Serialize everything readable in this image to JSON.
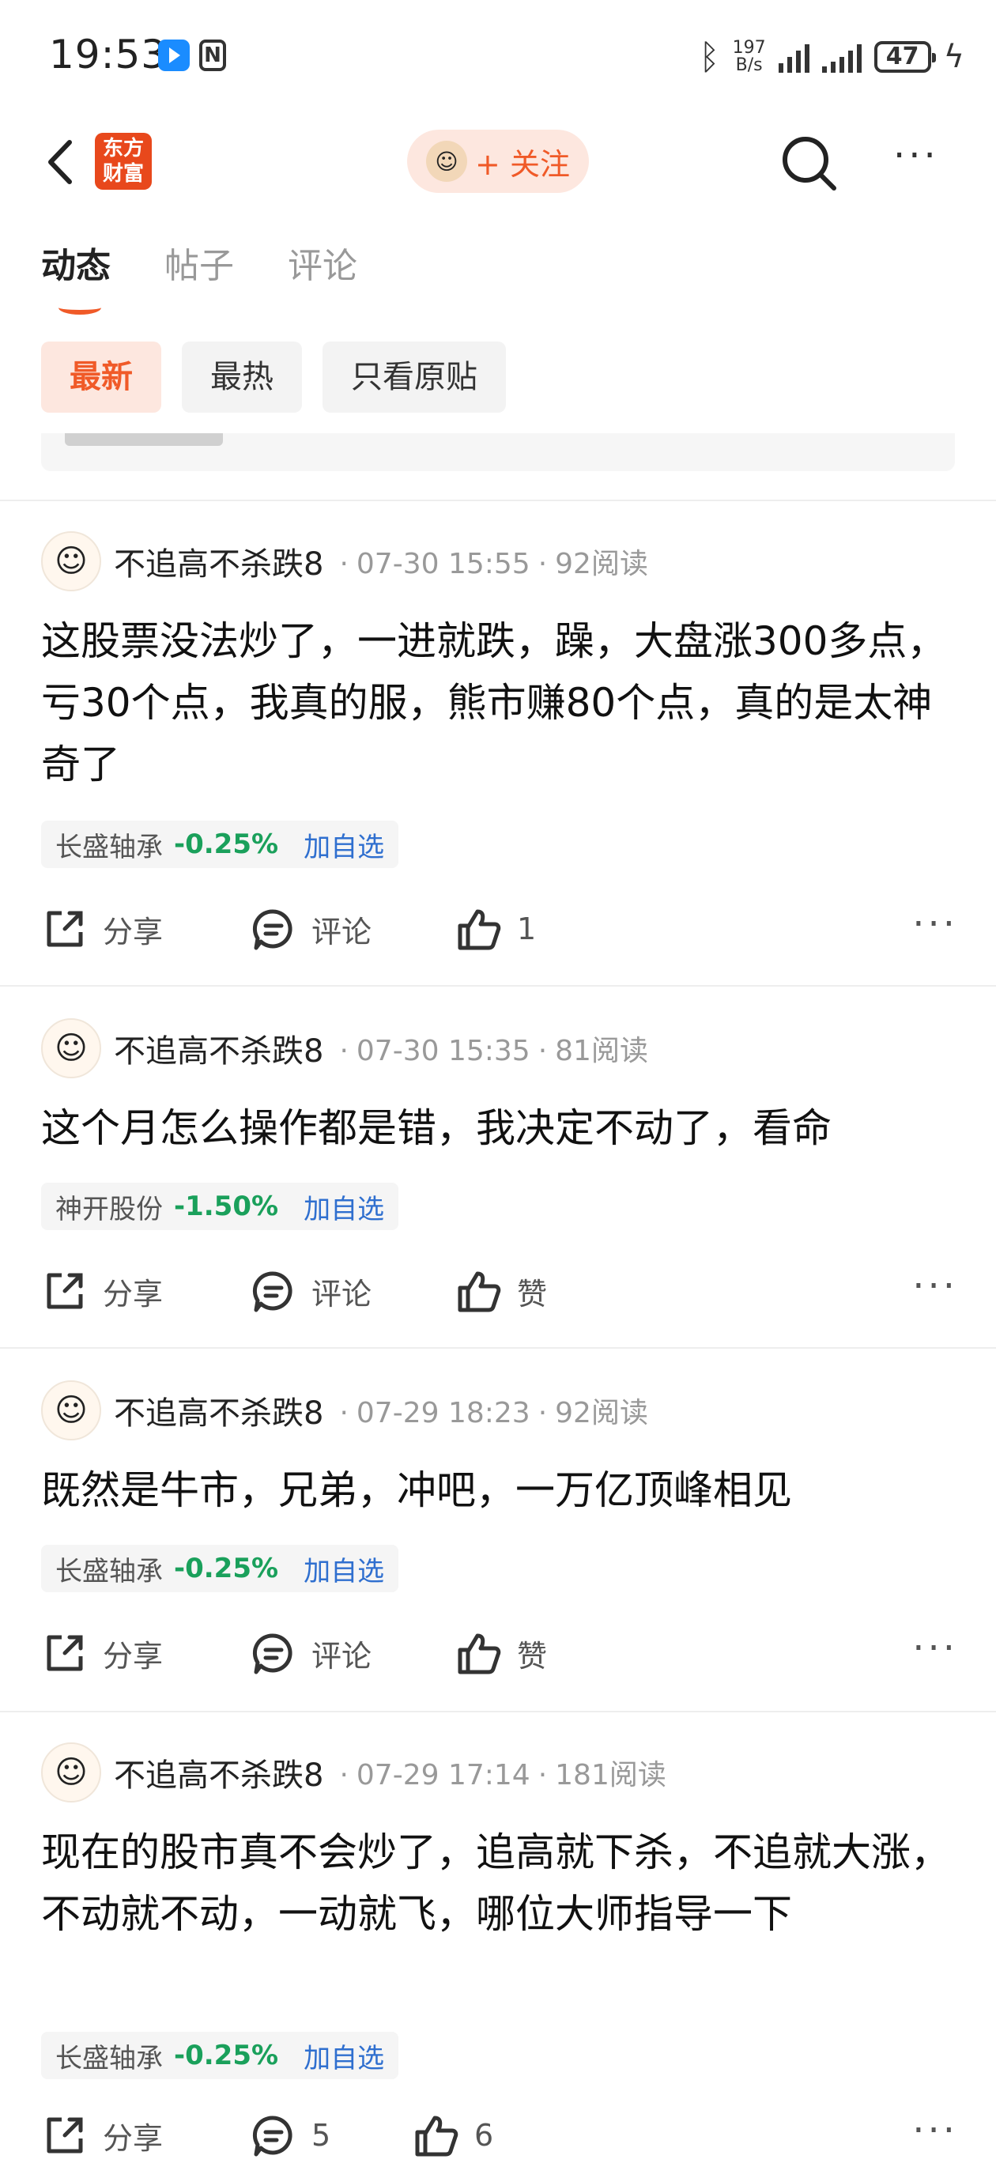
{
  "status_bar": {
    "time": "19:53",
    "net_speed_value": "197",
    "net_speed_unit": "B/s",
    "battery": "47"
  },
  "navbar": {
    "logo_line1": "东方",
    "logo_line2": "财富",
    "follow_label": "+ 关注"
  },
  "tabs": [
    "动态",
    "帖子",
    "评论"
  ],
  "filters": [
    "最新",
    "最热",
    "只看原贴"
  ],
  "colors": {
    "accent": "#f05a28",
    "stock_down": "#1aa05b",
    "link": "#2f6fcf"
  },
  "posts": [
    {
      "user": "不追高不杀跌8",
      "time": "07-30 15:55",
      "reads": "92阅读",
      "text": "这股票没法炒了，一进就跌，躁，大盘涨300多点，亏30个点，我真的服，熊市赚80个点，真的是太神奇了",
      "stock_name": "长盛轴承",
      "stock_change": "-0.25%",
      "add_label": "加自选",
      "share_label": "分享",
      "comment_label": "评论",
      "like_label": "1"
    },
    {
      "user": "不追高不杀跌8",
      "time": "07-30 15:35",
      "reads": "81阅读",
      "text": "这个月怎么操作都是错，我决定不动了，看命",
      "stock_name": "神开股份",
      "stock_change": "-1.50%",
      "add_label": "加自选",
      "share_label": "分享",
      "comment_label": "评论",
      "like_label": "赞"
    },
    {
      "user": "不追高不杀跌8",
      "time": "07-29 18:23",
      "reads": "92阅读",
      "text": "既然是牛市，兄弟，冲吧，一万亿顶峰相见",
      "stock_name": "长盛轴承",
      "stock_change": "-0.25%",
      "add_label": "加自选",
      "share_label": "分享",
      "comment_label": "评论",
      "like_label": "赞"
    },
    {
      "user": "不追高不杀跌8",
      "time": "07-29 17:14",
      "reads": "181阅读",
      "text": "现在的股市真不会炒了，追高就下杀，不追就大涨，不动就不动，一动就飞，哪位大师指导一下",
      "stock_name": "长盛轴承",
      "stock_change": "-0.25%",
      "add_label": "加自选",
      "share_label": "分享",
      "comment_label": "5",
      "like_label": "6"
    }
  ]
}
